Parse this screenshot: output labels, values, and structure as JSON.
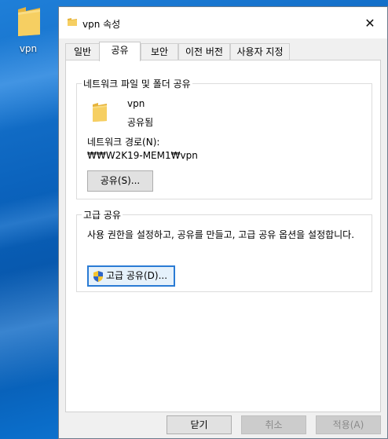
{
  "desktop": {
    "icon_label": "vpn"
  },
  "window": {
    "title": "vpn 속성",
    "close_glyph": "✕"
  },
  "tabs": [
    {
      "label": "일반"
    },
    {
      "label": "공유",
      "active": true
    },
    {
      "label": "보안"
    },
    {
      "label": "이전 버전"
    },
    {
      "label": "사용자 지정"
    }
  ],
  "network_share": {
    "group_title": "네트워크 파일 및 폴더 공유",
    "folder_name": "vpn",
    "status": "공유됨",
    "path_label": "네트워크 경로(N):",
    "path_value": "₩₩W2K19-MEM1₩vpn",
    "share_button": "공유(S)..."
  },
  "advanced_share": {
    "group_title": "고급 공유",
    "description": "사용 권한을 설정하고, 공유를 만들고, 고급 공유 옵션을 설정합니다.",
    "button": "고급 공유(D)..."
  },
  "footer": {
    "close_button": "닫기",
    "cancel_button": "취소",
    "apply_button": "적용(A)"
  },
  "colors": {
    "accent": "#2a7bd4",
    "folder": "#f2c14e",
    "desktop": "#0b63bd"
  }
}
